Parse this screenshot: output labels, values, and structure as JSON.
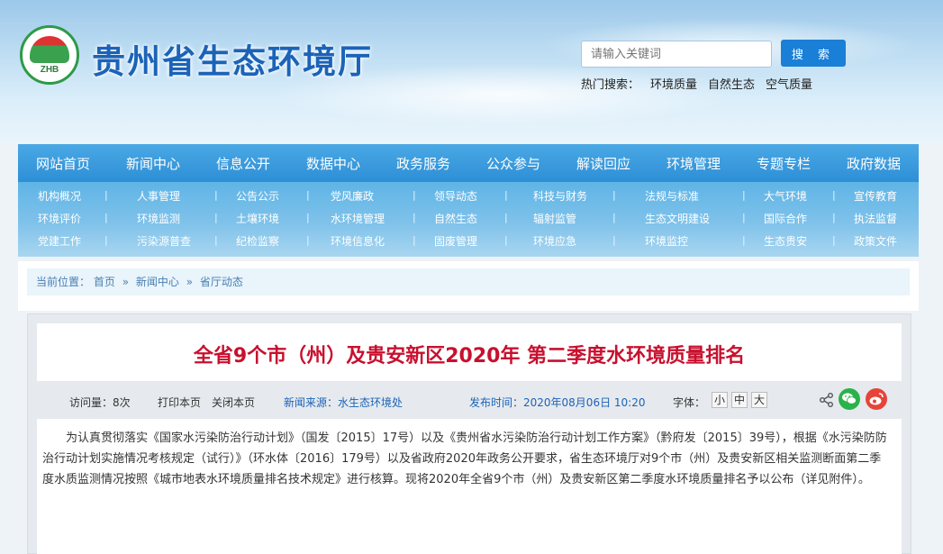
{
  "header": {
    "logo_abbr": "ZHB",
    "site_title": "贵州省生态环境厅",
    "search": {
      "placeholder": "请输入关键词",
      "button": "搜 索"
    },
    "hot_label": "热门搜索：",
    "hot_keywords": [
      "环境质量",
      "自然生态",
      "空气质量"
    ]
  },
  "nav": [
    "网站首页",
    "新闻中心",
    "信息公开",
    "数据中心",
    "政务服务",
    "公众参与",
    "解读回应",
    "环境管理",
    "专题专栏",
    "政府数据"
  ],
  "subnav": [
    [
      "机构概况",
      "人事管理",
      "公告公示",
      "党风廉政",
      "领导动态",
      "科技与财务",
      "法规与标准",
      "大气环境",
      "宣传教育"
    ],
    [
      "环境评价",
      "环境监测",
      "土壤环境",
      "水环境管理",
      "自然生态",
      "辐射监管",
      "生态文明建设",
      "国际合作",
      "执法监督"
    ],
    [
      "党建工作",
      "污染源普查",
      "纪检监察",
      "环境信息化",
      "固废管理",
      "环境应急",
      "环境监控",
      "生态贵安",
      "政策文件"
    ]
  ],
  "breadcrumb": {
    "label": "当前位置：",
    "items": [
      "首页",
      "新闻中心",
      "省厅动态"
    ],
    "sep": "»"
  },
  "article": {
    "title": "全省9个市（州）及贵安新区2020年 第二季度水环境质量排名",
    "views": "访问量：8次",
    "print": "打印本页",
    "close": "关闭本页",
    "source": "新闻来源：水生态环境处",
    "published": "发布时间：2020年08月06日 10:20",
    "font_label": "字体：",
    "font_small": "小",
    "font_medium": "中",
    "font_large": "大",
    "body": "为认真贯彻落实《国家水污染防治行动计划》（国发〔2015〕17号）以及《贵州省水污染防治行动计划工作方案》（黔府发〔2015〕39号），根据《水污染防防治行动计划实施情况考核规定（试行）》（环水体〔2016〕179号）以及省政府2020年政务公开要求，省生态环境厅对9个市（州）及贵安新区相关监测断面第二季度水质监测情况按照《城市地表水环境质量排名技术规定》进行核算。现将2020年全省9个市（州）及贵安新区第二季度水环境质量排名予以公布（详见附件）。"
  },
  "colors": {
    "brand_blue": "#1b63b8",
    "nav_blue": "#2d8fd6",
    "title_red": "#c8102e",
    "wechat": "#29b34a",
    "weibo": "#e6443a"
  },
  "icons": [
    "logo-emblem-icon",
    "share-icon",
    "wechat-icon",
    "weibo-icon"
  ]
}
